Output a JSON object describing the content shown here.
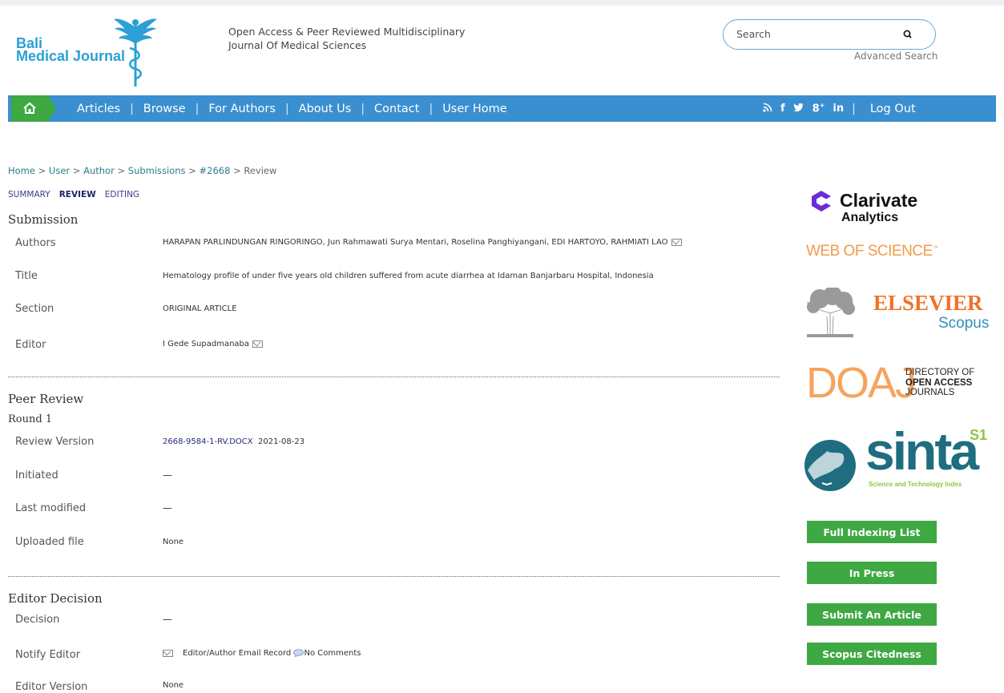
{
  "header": {
    "logo_line1": "Bali",
    "logo_line2": "Medical Journal",
    "tagline": "Open Access & Peer Reviewed Multidisciplinary Journal Of Medical Sciences",
    "search_placeholder": "Search",
    "advanced_search": "Advanced Search"
  },
  "nav": {
    "items": [
      "Articles",
      "Browse",
      "For Authors",
      "About Us",
      "Contact",
      "User Home"
    ],
    "separator": "|",
    "logout": "Log Out",
    "social": [
      "rss-icon",
      "facebook-icon",
      "twitter-icon",
      "google-plus-icon",
      "linkedin-icon"
    ]
  },
  "breadcrumb": {
    "items": [
      "Home",
      "User",
      "Author",
      "Submissions",
      "#2668"
    ],
    "current": "Review",
    "separator": ">"
  },
  "subtabs": {
    "summary": "SUMMARY",
    "review": "REVIEW",
    "editing": "EDITING"
  },
  "submission": {
    "heading": "Submission",
    "authors_label": "Authors",
    "authors": "HARAPAN PARLINDUNGAN RINGORINGO, Jun Rahmawati Surya Mentari, Roselina Panghiyangani, EDI HARTOYO, RAHMIATI LAO",
    "title_label": "Title",
    "title": "Hematology profile of under five years old children suffered from acute diarrhea at Idaman Banjarbaru Hospital, Indonesia",
    "section_label": "Section",
    "section": "ORIGINAL ARTICLE",
    "editor_label": "Editor",
    "editor": "I Gede Supadmanaba"
  },
  "peer_review": {
    "heading": "Peer Review",
    "round": "Round 1",
    "review_version_label": "Review Version",
    "review_version_file": "2668-9584-1-RV.DOCX",
    "review_version_date": "2021-08-23",
    "initiated_label": "Initiated",
    "initiated": "—",
    "last_modified_label": "Last modified",
    "last_modified": "—",
    "uploaded_file_label": "Uploaded file",
    "uploaded_file": "None"
  },
  "editor_decision": {
    "heading": "Editor Decision",
    "decision_label": "Decision",
    "decision": "—",
    "notify_label": "Notify Editor",
    "email_record": "Editor/Author Email Record",
    "no_comments": "No Comments",
    "editor_version_label": "Editor Version",
    "editor_version": "None"
  },
  "sidebar": {
    "clarivate_line1": "Clarivate",
    "clarivate_line2": "Analytics",
    "web_of_science": "WEB OF SCIENCE",
    "wos_tm": "™",
    "elsevier": "ELSEVIER",
    "scopus": "Scopus",
    "doaj": "DOAJ",
    "doaj_line1": "DIRECTORY OF",
    "doaj_line2": "OPEN ACCESS",
    "doaj_line3": "JOURNALS",
    "sinta": "sinta",
    "sinta_level": "S1",
    "sinta_sub": "Science and Technology Index",
    "buttons": [
      "Full Indexing List",
      "In Press",
      "Submit An Article",
      "Scopus Citedness"
    ]
  }
}
